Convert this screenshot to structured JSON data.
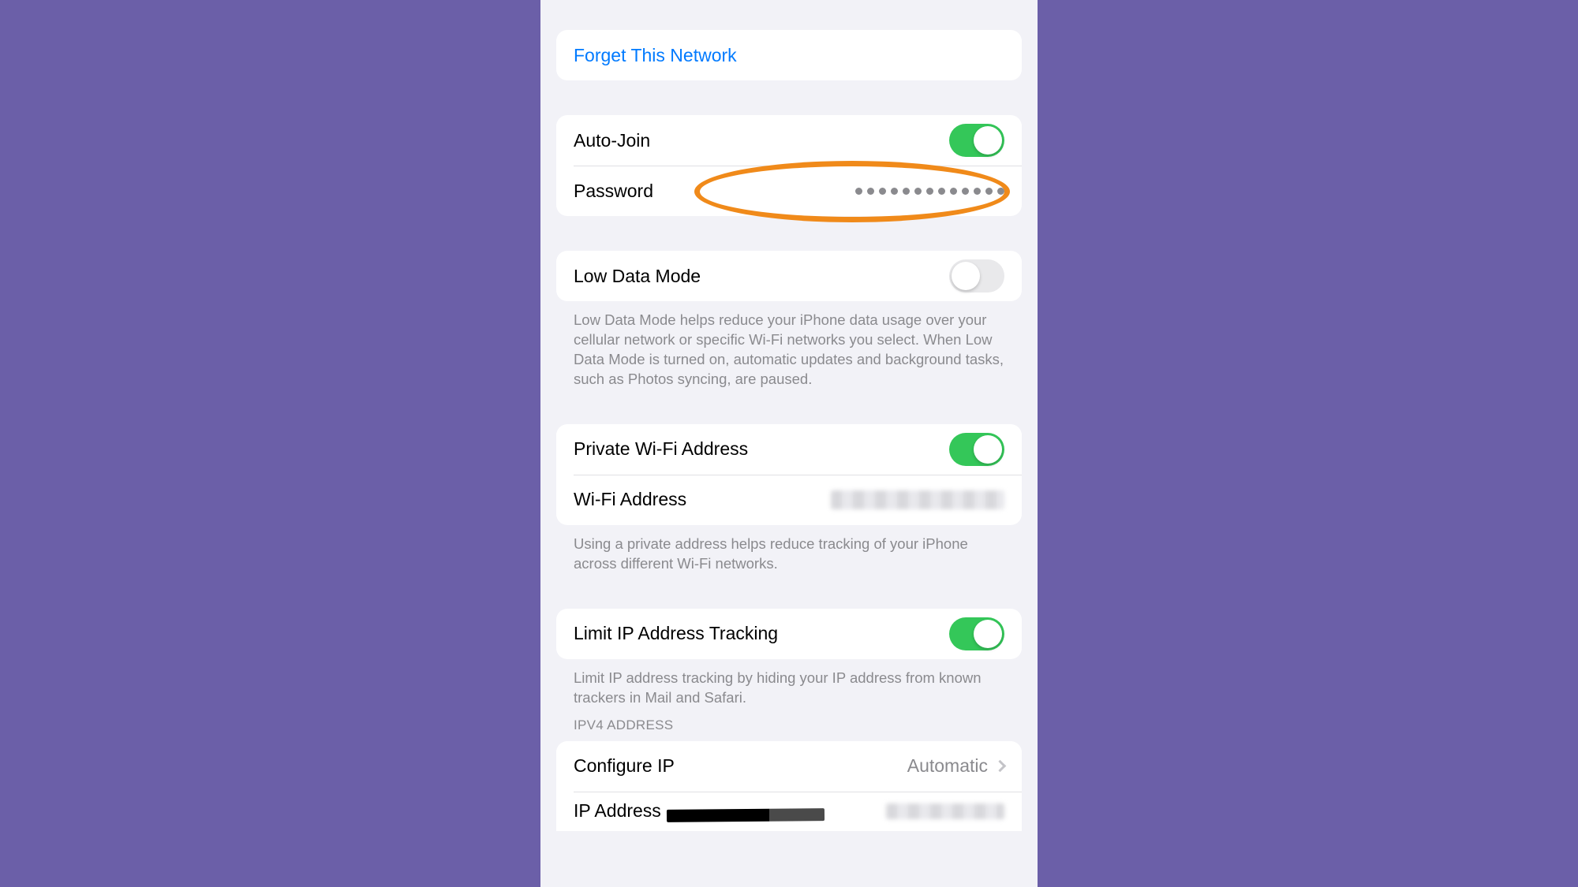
{
  "colors": {
    "background": "#6b5fa8",
    "panel": "#f2f2f7",
    "card": "#ffffff",
    "link": "#007aff",
    "toggle_on": "#34c759",
    "annotation": "#f08a1a"
  },
  "forget": {
    "label": "Forget This Network"
  },
  "auto_join": {
    "label": "Auto-Join",
    "enabled": true
  },
  "password": {
    "label": "Password",
    "mask_dots": 13
  },
  "low_data": {
    "label": "Low Data Mode",
    "enabled": false,
    "footer": "Low Data Mode helps reduce your iPhone data usage over your cellular network or specific Wi-Fi networks you select. When Low Data Mode is turned on, automatic updates and background tasks, such as Photos syncing, are paused."
  },
  "private_addr": {
    "label": "Private Wi-Fi Address",
    "enabled": true,
    "wifi_addr_label": "Wi-Fi Address",
    "wifi_addr_value_redacted": true,
    "footer": "Using a private address helps reduce tracking of your iPhone across different Wi-Fi networks."
  },
  "limit_ip": {
    "label": "Limit IP Address Tracking",
    "enabled": true,
    "footer": "Limit IP address tracking by hiding your IP address from known trackers in Mail and Safari."
  },
  "ipv4": {
    "section_header": "IPV4 Address",
    "configure_label": "Configure IP",
    "configure_value": "Automatic",
    "ip_label": "IP Address",
    "ip_value_redacted": true
  }
}
